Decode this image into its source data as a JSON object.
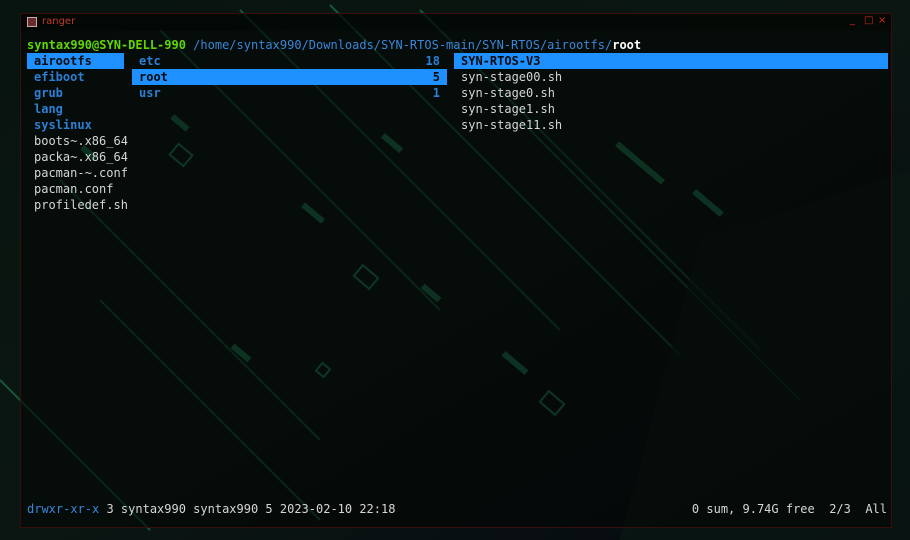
{
  "window": {
    "title": "ranger",
    "minimize": "_",
    "maximize": "□",
    "close": "×"
  },
  "pathbar": {
    "user_host": "syntax990@SYN-DELL-990",
    "path": " /home/syntax990/Downloads/SYN-RTOS-main/SYN-RTOS/airootfs/",
    "current": "root"
  },
  "parent_column": [
    {
      "name": "airootfs",
      "type": "dir",
      "selected": true
    },
    {
      "name": "efiboot",
      "type": "dir"
    },
    {
      "name": "grub",
      "type": "dir"
    },
    {
      "name": "lang",
      "type": "dir"
    },
    {
      "name": "syslinux",
      "type": "dir"
    },
    {
      "name": "boots~.x86_64",
      "type": "file"
    },
    {
      "name": "packa~.x86_64",
      "type": "file"
    },
    {
      "name": "pacman-~.conf",
      "type": "file"
    },
    {
      "name": "pacman.conf",
      "type": "file"
    },
    {
      "name": "profiledef.sh",
      "type": "file"
    }
  ],
  "current_column": [
    {
      "name": "etc",
      "count": "18",
      "type": "dir"
    },
    {
      "name": "root",
      "count": "5",
      "type": "dir",
      "selected": true
    },
    {
      "name": "usr",
      "count": "1",
      "type": "dir"
    }
  ],
  "preview_column": [
    {
      "name": "SYN-RTOS-V3",
      "type": "dir",
      "selected": true
    },
    {
      "name": "syn-stage00.sh",
      "type": "file"
    },
    {
      "name": "syn-stage0.sh",
      "type": "file"
    },
    {
      "name": "syn-stage1.sh",
      "type": "file"
    },
    {
      "name": "syn-stage11.sh",
      "type": "file"
    }
  ],
  "statusbar": {
    "permissions": "drwxr-xr-x",
    "info": " 3 syntax990 syntax990 5 2023-02-10 22:18",
    "right": "0 sum, 9.74G free  2/3  All"
  },
  "colors": {
    "selection": "#1e90ff",
    "directory": "#2d7fd4",
    "user_host": "#5fd700",
    "title": "#c0392b"
  }
}
